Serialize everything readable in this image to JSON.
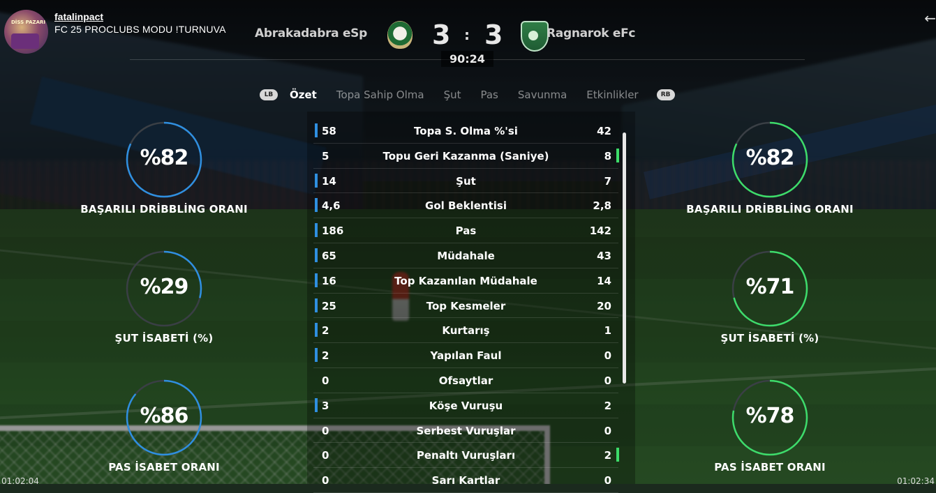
{
  "channel": {
    "name": "fatalinpact",
    "title": "FC 25 PROCLUBS MODU !TURNUVA",
    "avatar_text": "DİSS PAZARI"
  },
  "match": {
    "home_team": "Abrakadabra eSp",
    "away_team": "Ragnarok eFc",
    "home_score": "3",
    "away_score": "3",
    "separator": ":",
    "clock": "90:24"
  },
  "tabs": {
    "lb": "LB",
    "rb": "RB",
    "items": [
      "Özet",
      "Topa Sahip Olma",
      "Şut",
      "Pas",
      "Savunma",
      "Etkinlikler"
    ],
    "active": "Özet"
  },
  "stats": [
    {
      "label": "Topa S. Olma %'si",
      "home": "58",
      "away": "42",
      "leader": "home"
    },
    {
      "label": "Topu Geri Kazanma (Saniye)",
      "home": "5",
      "away": "8",
      "leader": "away"
    },
    {
      "label": "Şut",
      "home": "14",
      "away": "7",
      "leader": "home"
    },
    {
      "label": "Gol Beklentisi",
      "home": "4,6",
      "away": "2,8",
      "leader": "home"
    },
    {
      "label": "Pas",
      "home": "186",
      "away": "142",
      "leader": "home"
    },
    {
      "label": "Müdahale",
      "home": "65",
      "away": "43",
      "leader": "home"
    },
    {
      "label": "Top Kazanılan Müdahale",
      "home": "16",
      "away": "14",
      "leader": "home"
    },
    {
      "label": "Top Kesmeler",
      "home": "25",
      "away": "20",
      "leader": "home"
    },
    {
      "label": "Kurtarış",
      "home": "2",
      "away": "1",
      "leader": "home"
    },
    {
      "label": "Yapılan Faul",
      "home": "2",
      "away": "0",
      "leader": "home"
    },
    {
      "label": "Ofsaytlar",
      "home": "0",
      "away": "0",
      "leader": "none"
    },
    {
      "label": "Köşe Vuruşu",
      "home": "3",
      "away": "2",
      "leader": "home"
    },
    {
      "label": "Serbest Vuruşlar",
      "home": "0",
      "away": "0",
      "leader": "none"
    },
    {
      "label": "Penaltı Vuruşları",
      "home": "0",
      "away": "2",
      "leader": "away"
    },
    {
      "label": "Sarı Kartlar",
      "home": "0",
      "away": "0",
      "leader": "none"
    }
  ],
  "gauges": {
    "home": [
      {
        "value_text": "%82",
        "value": 82,
        "label": "BAŞARILI DRİBBLİNG ORANI"
      },
      {
        "value_text": "%29",
        "value": 29,
        "label": "ŞUT İSABETİ (%)"
      },
      {
        "value_text": "%86",
        "value": 86,
        "label": "PAS İSABET ORANI"
      }
    ],
    "away": [
      {
        "value_text": "%82",
        "value": 82,
        "label": "BAŞARILI DRİBBLİNG ORANI"
      },
      {
        "value_text": "%71",
        "value": 71,
        "label": "ŞUT İSABETİ (%)"
      },
      {
        "value_text": "%78",
        "value": 78,
        "label": "PAS İSABET ORANI"
      }
    ]
  },
  "timestamps": {
    "left": "01:02:04",
    "right": "01:02:34"
  },
  "colors": {
    "home_accent": "#2f8fe0",
    "away_accent": "#3ddc6a",
    "track": "#3a3f45"
  }
}
